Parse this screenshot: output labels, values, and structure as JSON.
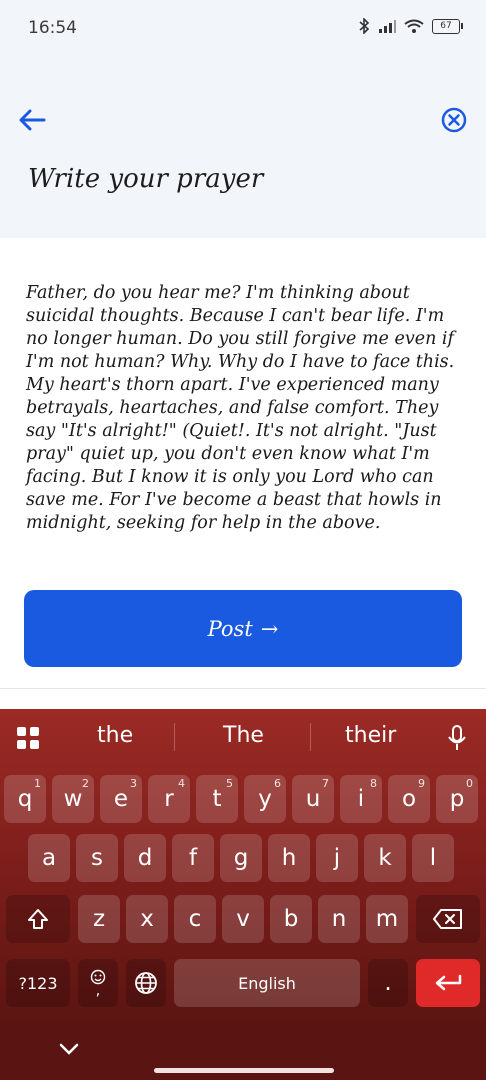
{
  "status_bar": {
    "time": "16:54",
    "battery": "67"
  },
  "header": {
    "title": "Write your prayer"
  },
  "prayer": {
    "text": "Father, do you hear me? I'm thinking about suicidal thoughts. Because I can't bear life. I'm no longer human. Do you still forgive me even if I'm not human? Why. Why do I have to face this. My heart's thorn apart. I've experienced many betrayals, heartaches, and false comfort. They say \"It's alright!\" (Quiet!. It's not alright. \"Just pray\" quiet up, you don't even know what I'm facing. But I know it is only you Lord who can save me. For I've become a beast that howls in midnight, seeking for help in the above."
  },
  "post_button": {
    "label": "Post",
    "arrow": "→"
  },
  "keyboard": {
    "suggestions": [
      "the",
      "The",
      "their"
    ],
    "row1": [
      {
        "key": "q",
        "num": "1"
      },
      {
        "key": "w",
        "num": "2"
      },
      {
        "key": "e",
        "num": "3"
      },
      {
        "key": "r",
        "num": "4"
      },
      {
        "key": "t",
        "num": "5"
      },
      {
        "key": "y",
        "num": "6"
      },
      {
        "key": "u",
        "num": "7"
      },
      {
        "key": "i",
        "num": "8"
      },
      {
        "key": "o",
        "num": "9"
      },
      {
        "key": "p",
        "num": "0"
      }
    ],
    "row2": [
      "a",
      "s",
      "d",
      "f",
      "g",
      "h",
      "j",
      "k",
      "l"
    ],
    "row3": [
      "z",
      "x",
      "c",
      "v",
      "b",
      "n",
      "m"
    ],
    "symbols_key": "?123",
    "emoji_key_sub": ",",
    "space_label": "English",
    "period_key": "."
  },
  "colors": {
    "accent": "#1a5ae0",
    "keyboard": "#8a2420",
    "enter": "#e02a2a"
  }
}
